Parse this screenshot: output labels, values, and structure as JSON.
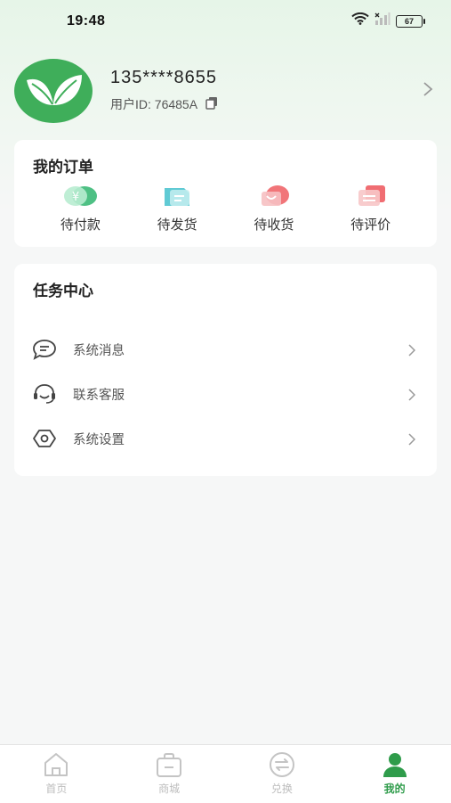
{
  "status_bar": {
    "time": "19:48",
    "battery": "67"
  },
  "profile": {
    "phone": "135****8655",
    "user_id": "用户ID: 76485A"
  },
  "orders": {
    "title": "我的订单",
    "items": [
      {
        "label": "待付款",
        "icon": "payment-icon",
        "color": "#41c58a"
      },
      {
        "label": "待发货",
        "icon": "shipping-icon",
        "color": "#5ac8cf"
      },
      {
        "label": "待收货",
        "icon": "receive-icon",
        "color": "#f06b6b"
      },
      {
        "label": "待评价",
        "icon": "review-icon",
        "color": "#f0787b"
      }
    ]
  },
  "tasks": {
    "title": "任务中心",
    "items": [
      {
        "label": "系统消息",
        "icon": "message-icon"
      },
      {
        "label": "联系客服",
        "icon": "headset-icon"
      },
      {
        "label": "系统设置",
        "icon": "settings-icon"
      }
    ]
  },
  "tabbar": {
    "items": [
      {
        "label": "首页",
        "icon": "home-icon"
      },
      {
        "label": "商城",
        "icon": "shop-icon"
      },
      {
        "label": "兑换",
        "icon": "exchange-icon"
      },
      {
        "label": "我的",
        "icon": "profile-icon",
        "active": true
      }
    ]
  },
  "colors": {
    "accent": "#2f9c4b",
    "brand_logo": "#3fae5a"
  }
}
